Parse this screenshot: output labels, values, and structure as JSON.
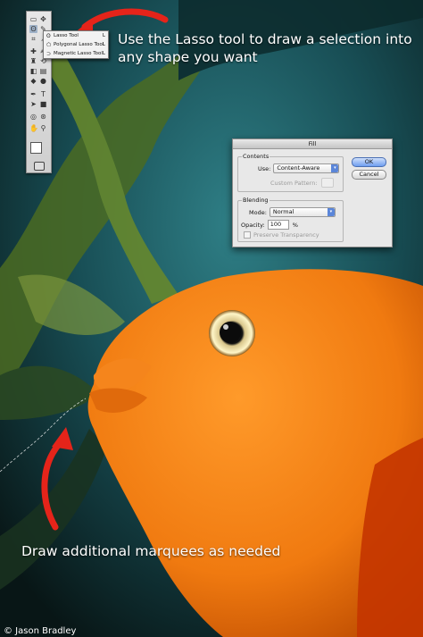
{
  "captions": {
    "top": "Use the Lasso tool to draw a selection into any shape you want",
    "bottom": "Draw additional marquees as needed",
    "credit": "© Jason Bradley"
  },
  "arrow_color": "#e5241a",
  "tools_flyout": {
    "items": [
      {
        "icon": "lasso-icon",
        "label": "Lasso Tool",
        "key": "L"
      },
      {
        "icon": "polygonal-lasso-icon",
        "label": "Polygonal Lasso Tool",
        "key": "L"
      },
      {
        "icon": "magnetic-lasso-icon",
        "label": "Magnetic Lasso Tool",
        "key": "L"
      }
    ]
  },
  "fill_dialog": {
    "title": "Fill",
    "contents_group": "Contents",
    "use_label": "Use:",
    "use_value": "Content-Aware",
    "custom_pattern_label": "Custom Pattern:",
    "blending_group": "Blending",
    "mode_label": "Mode:",
    "mode_value": "Normal",
    "opacity_label": "Opacity:",
    "opacity_value": "100",
    "opacity_unit": "%",
    "preserve_transparency_label": "Preserve Transparency",
    "ok_label": "OK",
    "cancel_label": "Cancel"
  }
}
